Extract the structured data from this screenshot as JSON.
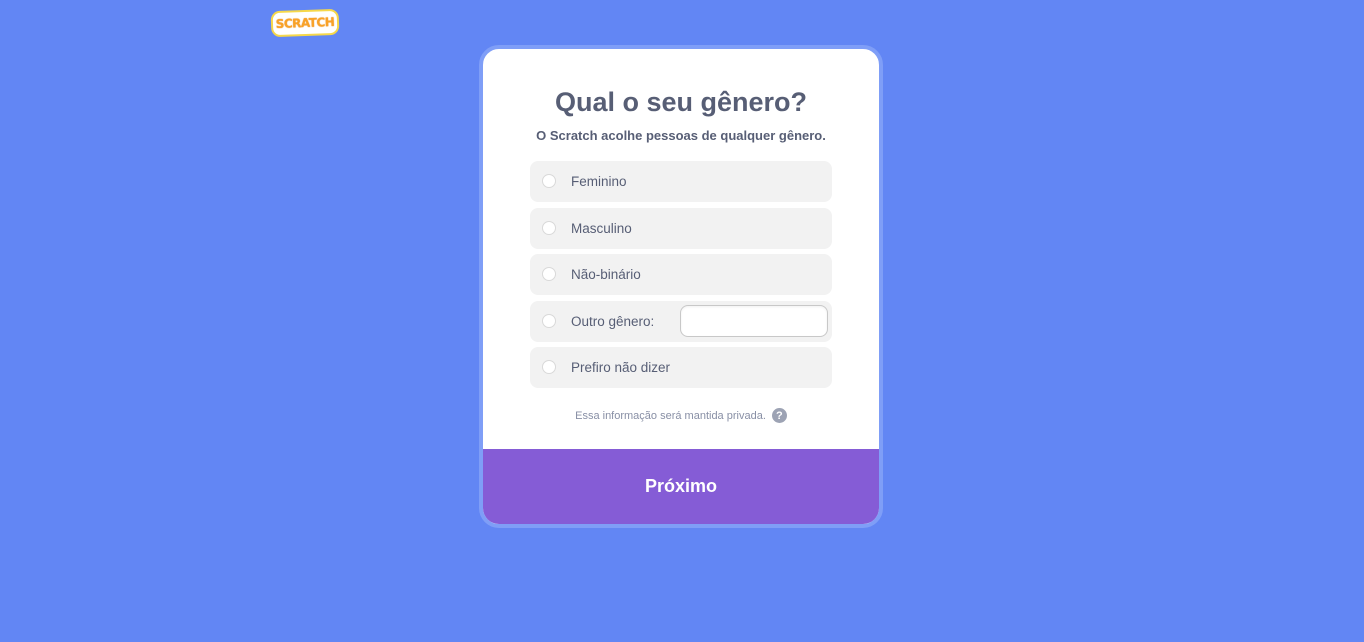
{
  "logo": {
    "text": "SCRATCH"
  },
  "page": {
    "title": "Qual o seu gênero?",
    "subtitle": "O Scratch acolhe pessoas de qualquer gênero."
  },
  "options": [
    {
      "label": "Feminino"
    },
    {
      "label": "Masculino"
    },
    {
      "label": "Não-binário"
    },
    {
      "label": "Outro gênero:",
      "input_value": ""
    },
    {
      "label": "Prefiro não dizer"
    }
  ],
  "privacy": {
    "text": "Essa informação será mantida privada.",
    "help_icon": "?"
  },
  "next_button": {
    "label": "Próximo"
  },
  "colors": {
    "background": "#6286f4",
    "card_border": "#7f9ef7",
    "text": "#575e75",
    "button": "#855cd6",
    "option_bg": "#f2f2f2"
  }
}
